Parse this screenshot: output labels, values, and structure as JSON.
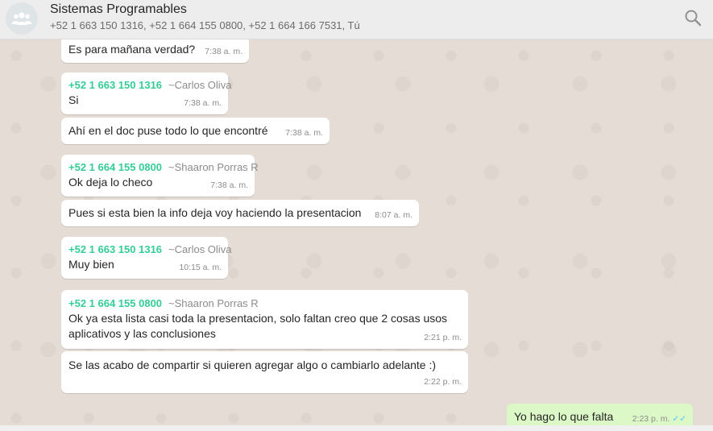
{
  "header": {
    "title": "Sistemas Programables",
    "members": "+52 1 663 150 1316, +52 1 664 155 0800, +52 1 664 166 7531, Tú",
    "avatar_icon": "group-icon",
    "search_icon": "search-icon"
  },
  "messages": [
    {
      "text": "Es para mañana verdad?",
      "time": "7:38 a. m."
    },
    {
      "phone": "+52 1 663 150 1316",
      "alias": "~Carlos Oliva",
      "text": "Si",
      "time": "7:38 a. m."
    },
    {
      "text": "Ahí en el doc puse todo lo que encontré",
      "time": "7:38 a. m."
    },
    {
      "phone": "+52 1 664 155 0800",
      "alias": "~Shaaron Porras R",
      "text": "Ok deja lo checo",
      "time": "7:38 a. m."
    },
    {
      "text": "Pues si esta bien la info deja voy haciendo la presentacion",
      "time": "8:07 a. m."
    },
    {
      "phone": "+52 1 663 150 1316",
      "alias": "~Carlos Oliva",
      "text": "Muy bien",
      "time": "10:15 a. m."
    },
    {
      "phone": "+52 1 664 155 0800",
      "alias": "~Shaaron Porras R",
      "text_line1": "Ok ya esta lista casi toda la presentacion, solo faltan creo que 2 cosas usos",
      "text_line2": "aplicativos y las conclusiones",
      "time": "2:21 p. m."
    },
    {
      "text": "Se las acabo de compartir si quieren agregar algo o cambiarlo adelante :)",
      "time": "2:22 p. m."
    },
    {
      "text": "Yo hago lo que falta",
      "time": "2:23 p. m.",
      "ticks": "✓✓"
    }
  ],
  "colors": {
    "chat_bg": "#e5ddd5",
    "sender_phone": "#35cd96",
    "outgoing_bubble": "#dcf8c6",
    "read_ticks": "#4fc3f7"
  }
}
